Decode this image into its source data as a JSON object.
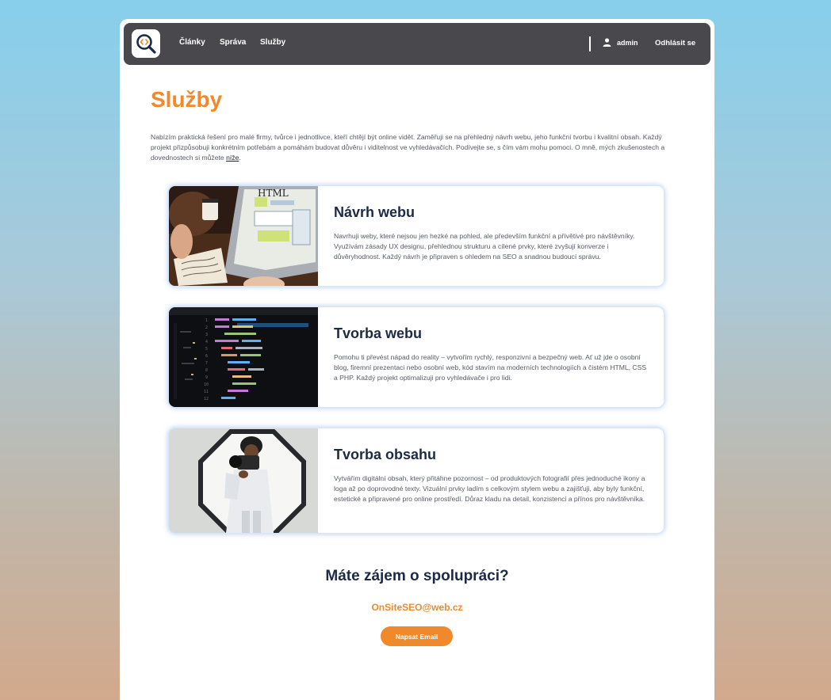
{
  "colors": {
    "accent": "#f0892b",
    "navbar": "#49484d",
    "heading": "#1d2a44"
  },
  "navbar": {
    "logo_icon": "magnifier-code-icon",
    "links": [
      "Články",
      "Správa",
      "Služby"
    ],
    "user_icon": "user-icon",
    "username": "admin",
    "logout": "Odhlásit se"
  },
  "main": {
    "title": "Služby",
    "intro_text": "Nabízím praktická řešení pro malé firmy, tvůrce i jednotlivce, kteří chtějí být online vidět. Zaměřuji se na přehledný návrh webu, jeho funkční tvorbu i kvalitní obsah. Každý projekt přizpůsobuji konkrétním potřebám a pomáhám budovat důvěru i viditelnost ve vyhledávačích. Podívejte se, s čím vám mohu pomoci. O mně, mých zkušenostech a dovednostech si můžete ",
    "intro_link": "níže",
    "intro_end": "."
  },
  "services": [
    {
      "title": "Návrh webu",
      "text": "Navrhuji weby, které nejsou jen hezké na pohled, ale především funkční a přívětivé pro návštěvníky. Využívám zásady UX designu, přehlednou strukturu a cílené prvky, které zvyšují konverze i důvěryhodnost. Každý návrh je připraven s ohledem na SEO a snadnou budoucí správu."
    },
    {
      "title": "Tvorba webu",
      "text": "Pomohu ti převést nápad do reality – vytvořím rychlý, responzivní a bezpečný web. Ať už jde o osobní blog, firemní prezentaci nebo osobní web, kód stavím na moderních technologiích a čistém HTML, CSS a PHP. Každý projekt optimalizuji pro vyhledávače i pro lidi."
    },
    {
      "title": "Tvorba obsahu",
      "text": "Vytvářím digitální obsah, který přitáhne pozornost – od produktových fotografií přes jednoduché ikony a loga až po doprovodné texty. Vizuální prvky ladím s celkovým stylem webu a zajišťuji, aby byly funkční, estetické a připravené pro online prostředí. Důraz kladu na detail, konzistenci a přínos pro návštěvníka."
    }
  ],
  "cta": {
    "title": "Máte zájem o spolupráci?",
    "email": "OnSiteSEO@web.cz",
    "button": "Napsat Email"
  }
}
